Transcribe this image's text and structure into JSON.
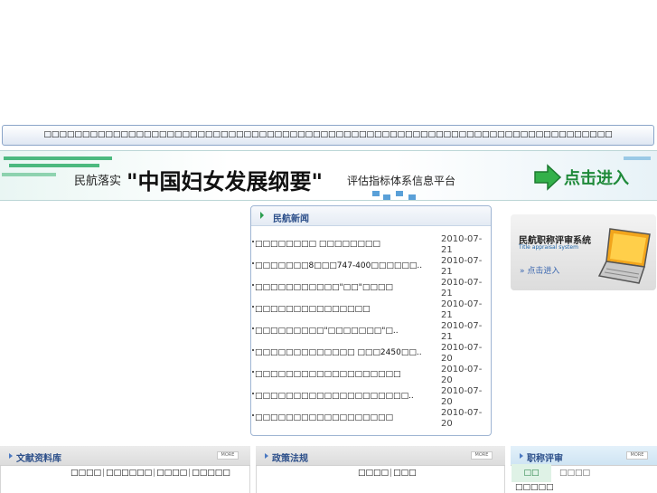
{
  "marquee": {
    "text": "□□□□□□□□□□□□□□□□□□□□□□□□□□□□□□□□□□□□□□□□□□□□□□□□□□□□□□□□□□□□□□□□□□□□□□□□□□"
  },
  "banner": {
    "prefix": "民航落实",
    "title": "\"中国妇女发展纲要\"",
    "suffix": "评估指标体系信息平台",
    "enter_label": "点击进入"
  },
  "news": {
    "title": "民航新闻",
    "items": [
      {
        "title": "□□□□□□□□ □□□□□□□□",
        "date": "2010-07-21"
      },
      {
        "title": "□□□□□□□8□□□747-400□□□□□□..",
        "date": "2010-07-21"
      },
      {
        "title": "□□□□□□□□□□□\"□□\"□□□□",
        "date": "2010-07-21"
      },
      {
        "title": "□□□□□□□□□□□□□□□",
        "date": "2010-07-21"
      },
      {
        "title": "□□□□□□□□□\"□□□□□□□\"□..",
        "date": "2010-07-21"
      },
      {
        "title": "□□□□□□□□□□□□□ □□□2450□□..",
        "date": "2010-07-20"
      },
      {
        "title": "□□□□□□□□□□□□□□□□□□□",
        "date": "2010-07-20"
      },
      {
        "title": "□□□□□□□□□□□□□□□□□□□□..",
        "date": "2010-07-20"
      },
      {
        "title": "□□□□□□□□□□□□□□□□□□",
        "date": "2010-07-20"
      }
    ]
  },
  "promo": {
    "title": "民航职称评审系统",
    "subtitle": "Title appraisal system",
    "enter": "点击进入"
  },
  "panels": {
    "docs": {
      "title": "文献资料库",
      "more": "MORE",
      "links": [
        "□□□□",
        "□□□□□□",
        "□□□□",
        "□□□□□"
      ]
    },
    "policy": {
      "title": "政策法规",
      "more": "MORE",
      "links": [
        "□□□□",
        "□□□"
      ]
    },
    "review": {
      "title": "职称评审",
      "more": "MORE",
      "tab_active": "□□",
      "tab_other": "□□□□",
      "content": "□□□□□"
    }
  },
  "colors": {
    "accent_green": "#2a9d4f",
    "title_blue": "#2c4f8a",
    "border_blue": "#9fb5d3"
  }
}
